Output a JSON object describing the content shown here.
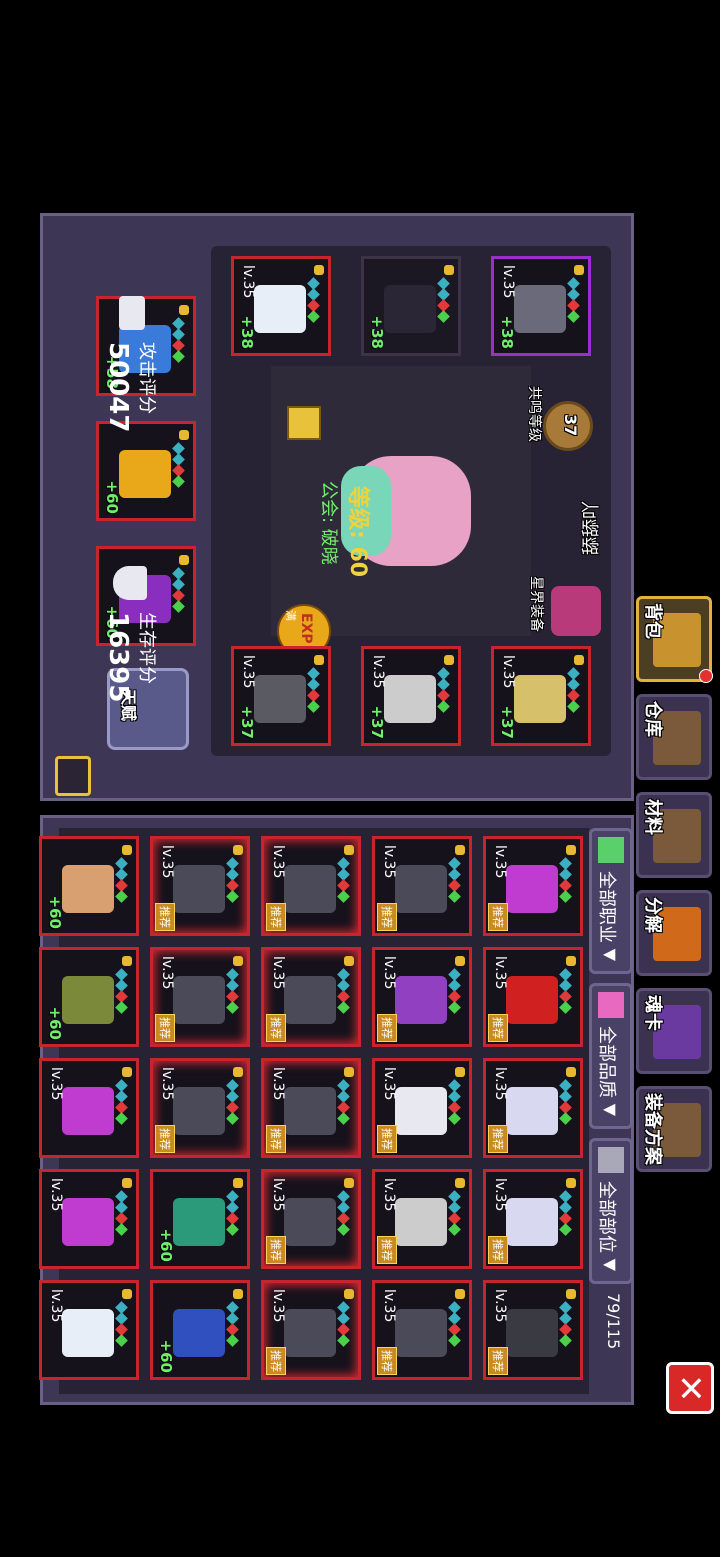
{
  "tabs": [
    {
      "label": "背包",
      "icon": "backpack-icon",
      "active": true
    },
    {
      "label": "仓库",
      "icon": "chest-icon"
    },
    {
      "label": "材料",
      "icon": "materials-icon"
    },
    {
      "label": "分解",
      "icon": "decompose-icon"
    },
    {
      "label": "魂卡",
      "icon": "soul-card-icon"
    },
    {
      "label": "装备方案",
      "icon": "equip-plan-icon"
    }
  ],
  "character": {
    "name": "舔舔吖",
    "level_text": "等级: 60",
    "guild_text": "公会: 破晓",
    "resonance_label": "共鸣等级",
    "resonance_level": "37",
    "astral_label": "星界装备",
    "exp_label": "EXP",
    "exp_badge": "满"
  },
  "equipped": [
    {
      "lv": "lv.35",
      "plus": "+38",
      "frame": "purple",
      "art": "#6a6a7a"
    },
    {
      "lv": "",
      "plus": "+38",
      "frame": "empty",
      "art": "#2a2636"
    },
    {
      "lv": "lv.35",
      "plus": "+38",
      "frame": "red",
      "art": "#e8eef8"
    },
    {
      "lv": "lv.35",
      "plus": "+37",
      "frame": "red",
      "art": "#d6c06a"
    },
    {
      "lv": "lv.35",
      "plus": "+37",
      "frame": "red",
      "art": "#cccccc"
    },
    {
      "lv": "lv.35",
      "plus": "+37",
      "frame": "red",
      "art": "#5a5a62"
    }
  ],
  "accessories": [
    {
      "plus": "+58",
      "art": "#3a7ad8"
    },
    {
      "plus": "+60",
      "art": "#e8a81a"
    },
    {
      "plus": "+60",
      "art": "#8a2ec0"
    }
  ],
  "talent_label": "天赋",
  "scores": {
    "attack_label": "攻击评分",
    "attack_value": "50047",
    "survival_label": "生存评分",
    "survival_value": "16395"
  },
  "filters": [
    {
      "label": "全部职业",
      "icon": "class-filter-icon"
    },
    {
      "label": "全部品质",
      "icon": "quality-filter-icon"
    },
    {
      "label": "全部部位",
      "icon": "slot-filter-icon"
    }
  ],
  "capacity": "79/115",
  "recommend_label": "推荐",
  "inventory_rows": [
    [
      {
        "lv": "lv.35",
        "art": "#c03bd0",
        "rec": true
      },
      {
        "lv": "lv.35",
        "art": "#d02020",
        "rec": true
      },
      {
        "lv": "lv.35",
        "art": "#d8d8f0",
        "rec": true
      },
      {
        "lv": "lv.35",
        "art": "#d8d8f0",
        "rec": true
      },
      {
        "lv": "lv.35",
        "art": "#3a3a42",
        "rec": true
      }
    ],
    [
      {
        "lv": "lv.35",
        "art": "#4a4a58",
        "rec": true
      },
      {
        "lv": "lv.35",
        "art": "#9040c0",
        "rec": true
      },
      {
        "lv": "lv.35",
        "art": "#e8e8f0",
        "rec": true
      },
      {
        "lv": "lv.35",
        "art": "#cccccc",
        "rec": true
      },
      {
        "lv": "lv.35",
        "art": "#4a4a58",
        "rec": true
      }
    ],
    [
      {
        "lv": "lv.35",
        "art": "#4a4a58",
        "rec": true,
        "glow": true
      },
      {
        "lv": "lv.35",
        "art": "#4a4a58",
        "rec": true,
        "glow": true
      },
      {
        "lv": "lv.35",
        "art": "#4a4a58",
        "rec": true,
        "glow": true
      },
      {
        "lv": "lv.35",
        "art": "#4a4a58",
        "rec": true,
        "glow": true
      },
      {
        "lv": "lv.35",
        "art": "#4a4a58",
        "rec": true,
        "glow": true
      }
    ],
    [
      {
        "lv": "lv.35",
        "art": "#4a4a58",
        "rec": true,
        "glow": true
      },
      {
        "lv": "lv.35",
        "art": "#4a4a58",
        "rec": true,
        "glow": true
      },
      {
        "lv": "lv.35",
        "art": "#4a4a58",
        "rec": true,
        "glow": true
      },
      {
        "plus": "+60",
        "art": "#2a9a7a"
      },
      {
        "plus": "+60",
        "art": "#3050c0"
      }
    ],
    [
      {
        "plus": "+60",
        "art": "#d8a070"
      },
      {
        "plus": "+60",
        "art": "#7a8a3a"
      },
      {
        "lv": "lv.35",
        "art": "#c03bd0"
      },
      {
        "lv": "lv.35",
        "art": "#c03bd0"
      },
      {
        "lv": "lv.35",
        "art": "#e8eef8"
      }
    ]
  ]
}
